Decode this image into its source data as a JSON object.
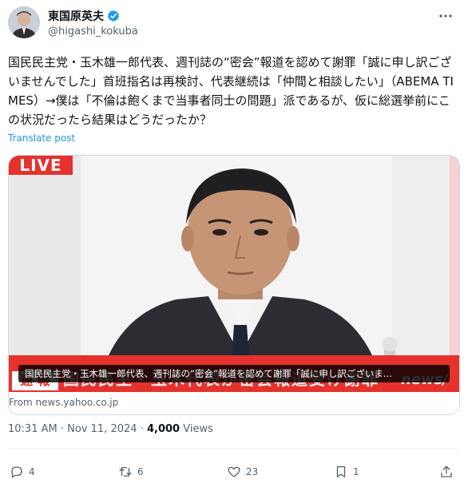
{
  "author": {
    "name": "東国原英夫",
    "handle": "@higashi_kokuba",
    "verified": true,
    "verified_color": "#1d9bf0"
  },
  "tweet": {
    "text": "国民民主党・玉木雄一郎代表、週刊誌の“密会”報道を認めて謝罪「誠に申し訳ございませんでした」首班指名は再検討、代表継続は「仲間と相談したい」（ABEMA TIMES）→僕は「不倫は飽くまで当事者同士の問題」派であるが、仮に総選挙前にこの状況だったら結果はどうだったか？",
    "translate_label": "Translate post"
  },
  "media": {
    "live_label": "LIVE",
    "breaking_label": "速 報",
    "banner_text": "国民民主・玉木代表が密会報道受け謝罪",
    "brand": "news/",
    "caption": "国民民主党・玉木雄一郎代表、週刊誌の“密会”報道を認めて謝罪「誠に申し訳ございま...",
    "source": "From news.yahoo.co.jp"
  },
  "meta": {
    "time": "10:31 AM",
    "separator": "·",
    "date": "Nov 11, 2024",
    "views_count": "4,000",
    "views_label": "Views"
  },
  "actions": {
    "replies": "4",
    "reposts": "6",
    "likes": "23",
    "bookmarks": "1"
  },
  "colors": {
    "accent": "#1d9bf0",
    "live_red": "#e5322d",
    "text_primary": "#0f1419",
    "text_secondary": "#536471"
  },
  "icons": [
    "verified-badge-icon",
    "more-icon",
    "reply-icon",
    "repost-icon",
    "like-icon",
    "bookmark-icon",
    "share-icon"
  ]
}
